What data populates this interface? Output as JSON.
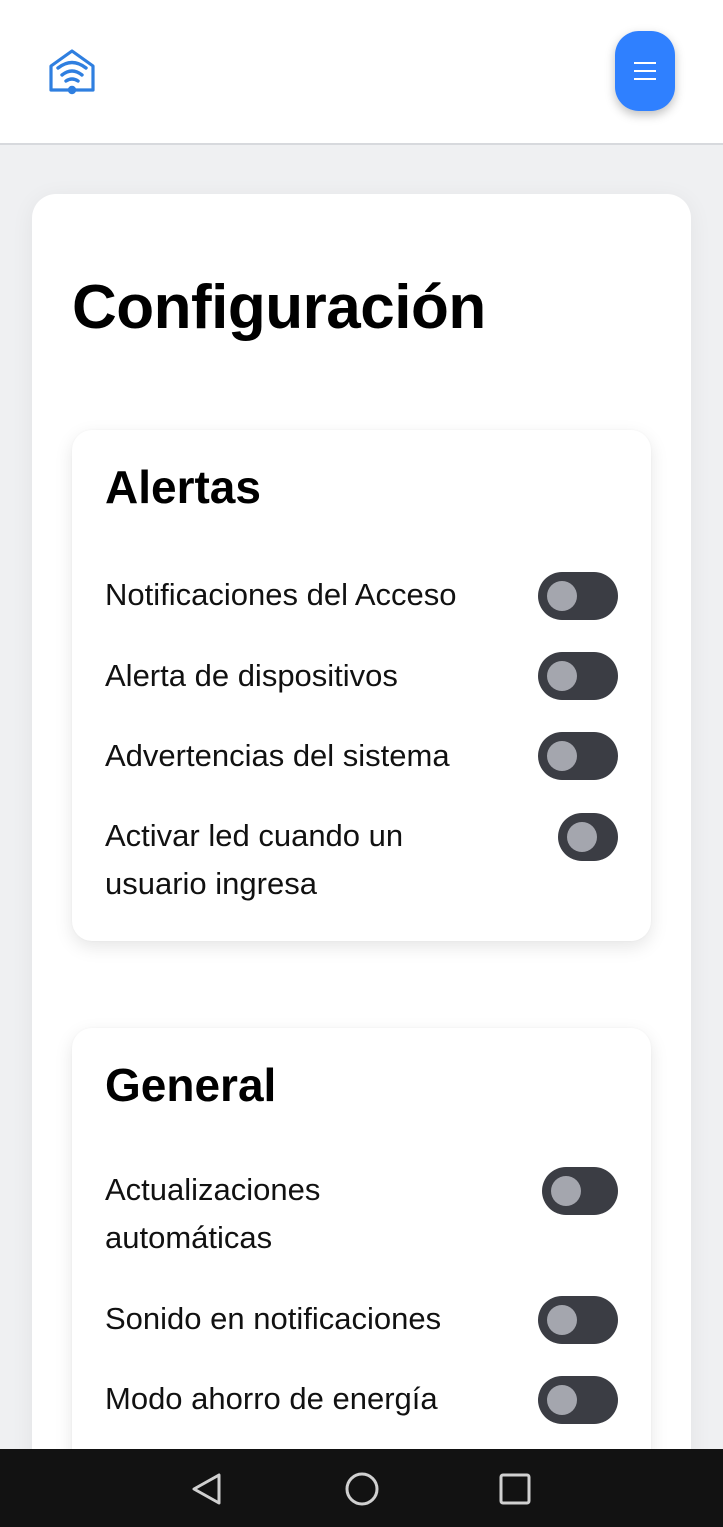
{
  "header": {
    "logo_icon": "wifi-house-icon",
    "menu_icon": "hamburger-menu-icon",
    "menu_button_color": "#2f80ff"
  },
  "page": {
    "title": "Configuración"
  },
  "sections": {
    "alerts": {
      "title": "Alertas",
      "items": [
        {
          "label": "Notificaciones del Acceso",
          "enabled": false
        },
        {
          "label": "Alerta de dispositivos",
          "enabled": false
        },
        {
          "label": "Advertencias del sistema",
          "enabled": false
        },
        {
          "label": "Activar led cuando un usuario ingresa",
          "enabled": false
        }
      ]
    },
    "general": {
      "title": "General",
      "items": [
        {
          "label": "Actualizaciones automáticas",
          "enabled": false
        },
        {
          "label": "Sonido en notificaciones",
          "enabled": false
        },
        {
          "label": "Modo ahorro de energía",
          "enabled": false
        }
      ]
    }
  },
  "system_nav": {
    "back_icon": "back-triangle-icon",
    "home_icon": "home-circle-icon",
    "recents_icon": "recents-square-icon"
  },
  "colors": {
    "toggle_track": "#3b3d44",
    "toggle_knob": "#a4a6ae",
    "accent": "#2f80ff"
  }
}
